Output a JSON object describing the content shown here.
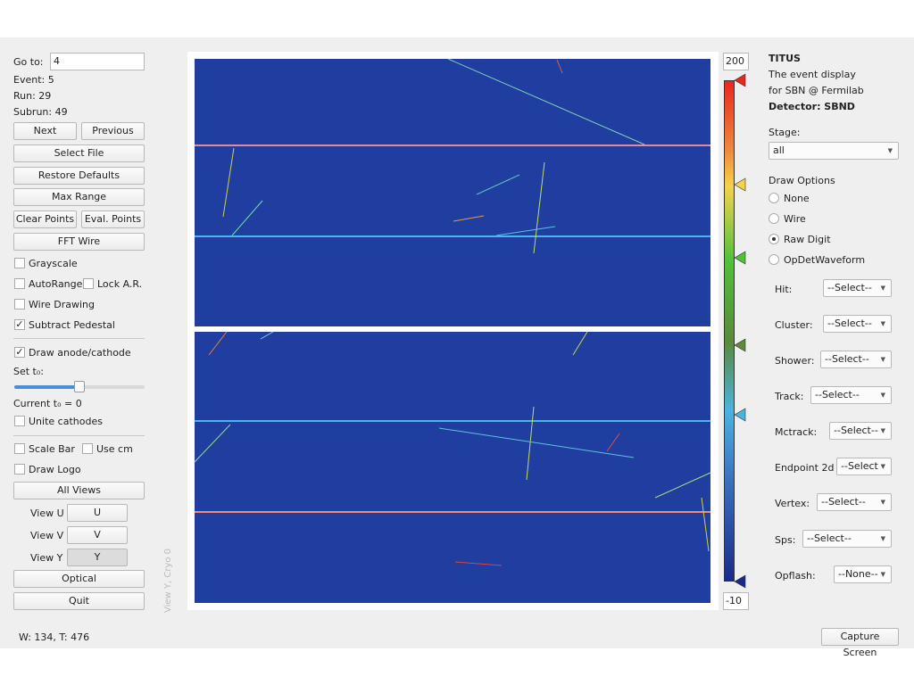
{
  "left": {
    "goto_label": "Go to:",
    "goto_value": "4",
    "event": "Event: 5",
    "run": "Run: 29",
    "subrun": "Subrun: 49",
    "next": "Next",
    "previous": "Previous",
    "select_file": "Select File",
    "restore_defaults": "Restore Defaults",
    "max_range": "Max Range",
    "clear_points": "Clear Points",
    "eval_points": "Eval. Points",
    "fft_wire": "FFT Wire",
    "grayscale": "Grayscale",
    "autorange": "AutoRange",
    "lock_ar": "Lock A.R.",
    "wire_drawing": "Wire Drawing",
    "subtract_pedestal": "Subtract Pedestal",
    "draw_anode": "Draw anode/cathode",
    "set_t0": "Set t₀:",
    "t0_slider_percent": 50,
    "current_t0": "Current t₀ = 0",
    "unite_cathodes": "Unite cathodes",
    "scale_bar": "Scale Bar",
    "use_cm": "Use cm",
    "draw_logo": "Draw Logo",
    "all_views": "All Views",
    "view_u_label": "View U",
    "view_u": "U",
    "view_v_label": "View V",
    "view_v": "V",
    "view_y_label": "View Y",
    "view_y": "Y",
    "optical": "Optical",
    "quit": "Quit",
    "checked": {
      "grayscale": false,
      "autorange": false,
      "lock_ar": false,
      "wire_drawing": false,
      "subtract_pedestal": true,
      "draw_anode": true,
      "unite_cathodes": false,
      "scale_bar": false,
      "use_cm": false,
      "draw_logo": false
    }
  },
  "view_label": "View Y, Cryo 0",
  "status": "W: 134, T: 476",
  "colorbar": {
    "max": "200",
    "min": "-10",
    "colors": [
      "#e8281e",
      "#f5d24a",
      "#4fc23a",
      "#5a8a3a",
      "#4ab4e0",
      "#1a2a8c"
    ]
  },
  "right": {
    "title": "TITUS",
    "line1": "The event display",
    "line2": "for SBN @ Fermilab",
    "detector": "Detector: SBND",
    "stage_label": "Stage:",
    "stage_value": "all",
    "draw_options": "Draw Options",
    "radios": [
      "None",
      "Wire",
      "Raw Digit",
      "OpDetWaveform"
    ],
    "radio_selected": "Raw Digit",
    "hit": "Hit:",
    "cluster": "Cluster:",
    "shower": "Shower:",
    "track": "Track:",
    "mctrack": "Mctrack:",
    "endpoint": "Endpoint 2d",
    "vertex": "Vertex:",
    "sps": "Sps:",
    "opflash": "Opflash:",
    "select": "--Select--",
    "select_cut": "--Select",
    "none": "--None--"
  },
  "capture": "Capture Screen",
  "display_color": "#1f3ea0"
}
